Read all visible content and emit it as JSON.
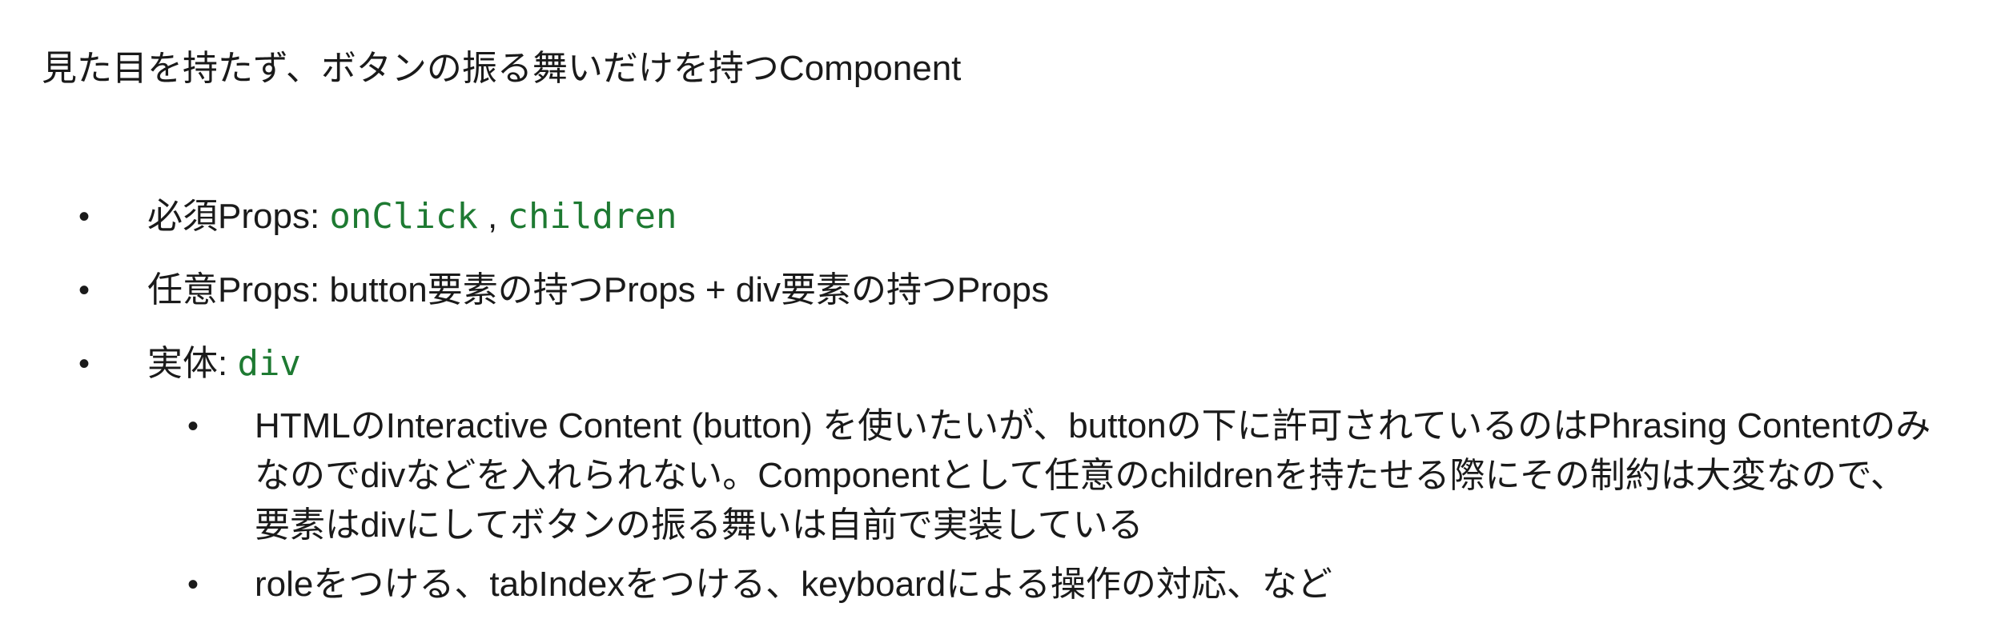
{
  "title": "見た目を持たず、ボタンの振る舞いだけを持つComponent",
  "items": [
    {
      "prefix": "必須Props: ",
      "code1": "onClick",
      "sep": " , ",
      "code2": "children"
    },
    {
      "text": "任意Props: button要素の持つProps + div要素の持つProps"
    },
    {
      "prefix": "実体: ",
      "code1": "div"
    }
  ],
  "sub_items": [
    {
      "lines": [
        "HTMLのInteractive Content (button) を使いたいが、buttonの下に許可されているのはPhrasing Contentのみ",
        "なのでdivなどを入れられない。Componentとして任意のchildrenを持たせる際にその制約は大変なので、",
        "要素はdivにしてボタンの振る舞いは自前で実装している"
      ]
    },
    {
      "lines": [
        "roleをつける、tabIndexをつける、keyboardによる操作の対応、など"
      ]
    }
  ],
  "bullet_glyph": "•",
  "colors": {
    "text": "#1a1a1a",
    "code": "#1e7a32",
    "background": "#ffffff"
  }
}
